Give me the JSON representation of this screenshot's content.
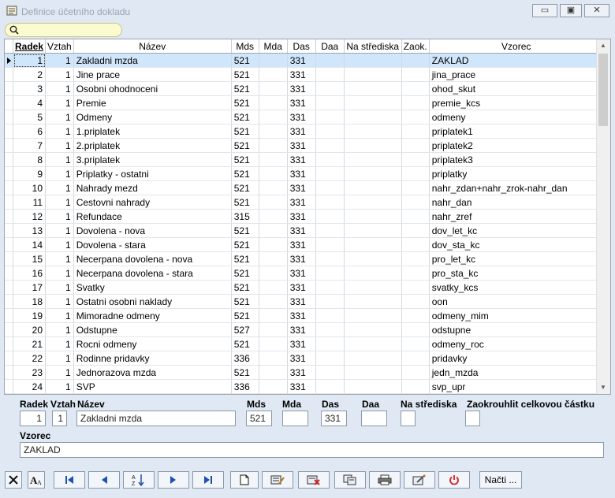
{
  "window": {
    "title": "Definice účetního dokladu"
  },
  "search": {
    "placeholder": ""
  },
  "grid": {
    "columns": [
      "Radek",
      "Vztah",
      "Název",
      "Mds",
      "Mda",
      "Das",
      "Daa",
      "Na střediska",
      "Zaok.",
      "Vzorec"
    ],
    "rows": [
      [
        "1",
        "1",
        "Zakladni mzda",
        "521",
        "",
        "331",
        "",
        "",
        "",
        "ZAKLAD"
      ],
      [
        "2",
        "1",
        "Jine prace",
        "521",
        "",
        "331",
        "",
        "",
        "",
        "jina_prace"
      ],
      [
        "3",
        "1",
        "Osobni ohodnoceni",
        "521",
        "",
        "331",
        "",
        "",
        "",
        "ohod_skut"
      ],
      [
        "4",
        "1",
        "Premie",
        "521",
        "",
        "331",
        "",
        "",
        "",
        "premie_kcs"
      ],
      [
        "5",
        "1",
        "Odmeny",
        "521",
        "",
        "331",
        "",
        "",
        "",
        "odmeny"
      ],
      [
        "6",
        "1",
        "1.priplatek",
        "521",
        "",
        "331",
        "",
        "",
        "",
        "priplatek1"
      ],
      [
        "7",
        "1",
        "2.priplatek",
        "521",
        "",
        "331",
        "",
        "",
        "",
        "priplatek2"
      ],
      [
        "8",
        "1",
        "3.priplatek",
        "521",
        "",
        "331",
        "",
        "",
        "",
        "priplatek3"
      ],
      [
        "9",
        "1",
        "Priplatky - ostatni",
        "521",
        "",
        "331",
        "",
        "",
        "",
        "priplatky"
      ],
      [
        "10",
        "1",
        "Nahrady mezd",
        "521",
        "",
        "331",
        "",
        "",
        "",
        "nahr_zdan+nahr_zrok-nahr_dan"
      ],
      [
        "11",
        "1",
        "Cestovni nahrady",
        "521",
        "",
        "331",
        "",
        "",
        "",
        "nahr_dan"
      ],
      [
        "12",
        "1",
        "Refundace",
        "315",
        "",
        "331",
        "",
        "",
        "",
        "nahr_zref"
      ],
      [
        "13",
        "1",
        "Dovolena - nova",
        "521",
        "",
        "331",
        "",
        "",
        "",
        "dov_let_kc"
      ],
      [
        "14",
        "1",
        "Dovolena - stara",
        "521",
        "",
        "331",
        "",
        "",
        "",
        "dov_sta_kc"
      ],
      [
        "15",
        "1",
        "Necerpana dovolena - nova",
        "521",
        "",
        "331",
        "",
        "",
        "",
        "pro_let_kc"
      ],
      [
        "16",
        "1",
        "Necerpana dovolena - stara",
        "521",
        "",
        "331",
        "",
        "",
        "",
        "pro_sta_kc"
      ],
      [
        "17",
        "1",
        "Svatky",
        "521",
        "",
        "331",
        "",
        "",
        "",
        "svatky_kcs"
      ],
      [
        "18",
        "1",
        "Ostatni osobni naklady",
        "521",
        "",
        "331",
        "",
        "",
        "",
        "oon"
      ],
      [
        "19",
        "1",
        "Mimoradne odmeny",
        "521",
        "",
        "331",
        "",
        "",
        "",
        "odmeny_mim"
      ],
      [
        "20",
        "1",
        "Odstupne",
        "527",
        "",
        "331",
        "",
        "",
        "",
        "odstupne"
      ],
      [
        "21",
        "1",
        "Rocni odmeny",
        "521",
        "",
        "331",
        "",
        "",
        "",
        "odmeny_roc"
      ],
      [
        "22",
        "1",
        "Rodinne pridavky",
        "336",
        "",
        "331",
        "",
        "",
        "",
        "pridavky"
      ],
      [
        "23",
        "1",
        "Jednorazova mzda",
        "521",
        "",
        "331",
        "",
        "",
        "",
        "jedn_mzda"
      ],
      [
        "24",
        "1",
        "SVP",
        "336",
        "",
        "331",
        "",
        "",
        "",
        "svp_upr"
      ]
    ]
  },
  "detail": {
    "labels": {
      "radek": "Radek",
      "vztah": "Vztah",
      "nazev": "Název",
      "mds": "Mds",
      "mda": "Mda",
      "das": "Das",
      "daa": "Daa",
      "na_strediska": "Na střediska",
      "zaok": "Zaokrouhlit celkovou částku",
      "vzorec": "Vzorec"
    },
    "values": {
      "radek": "1",
      "vztah": "1",
      "nazev": "Zakladni mzda",
      "mds": "521",
      "mda": "",
      "das": "331",
      "daa": "",
      "vzorec": "ZAKLAD"
    }
  },
  "toolbar": {
    "load_label": "Načti ..."
  },
  "colors": {
    "selected_row": "#cfe6fb",
    "search_bg": "#fbfbcf",
    "power_icon": "#d42020"
  }
}
